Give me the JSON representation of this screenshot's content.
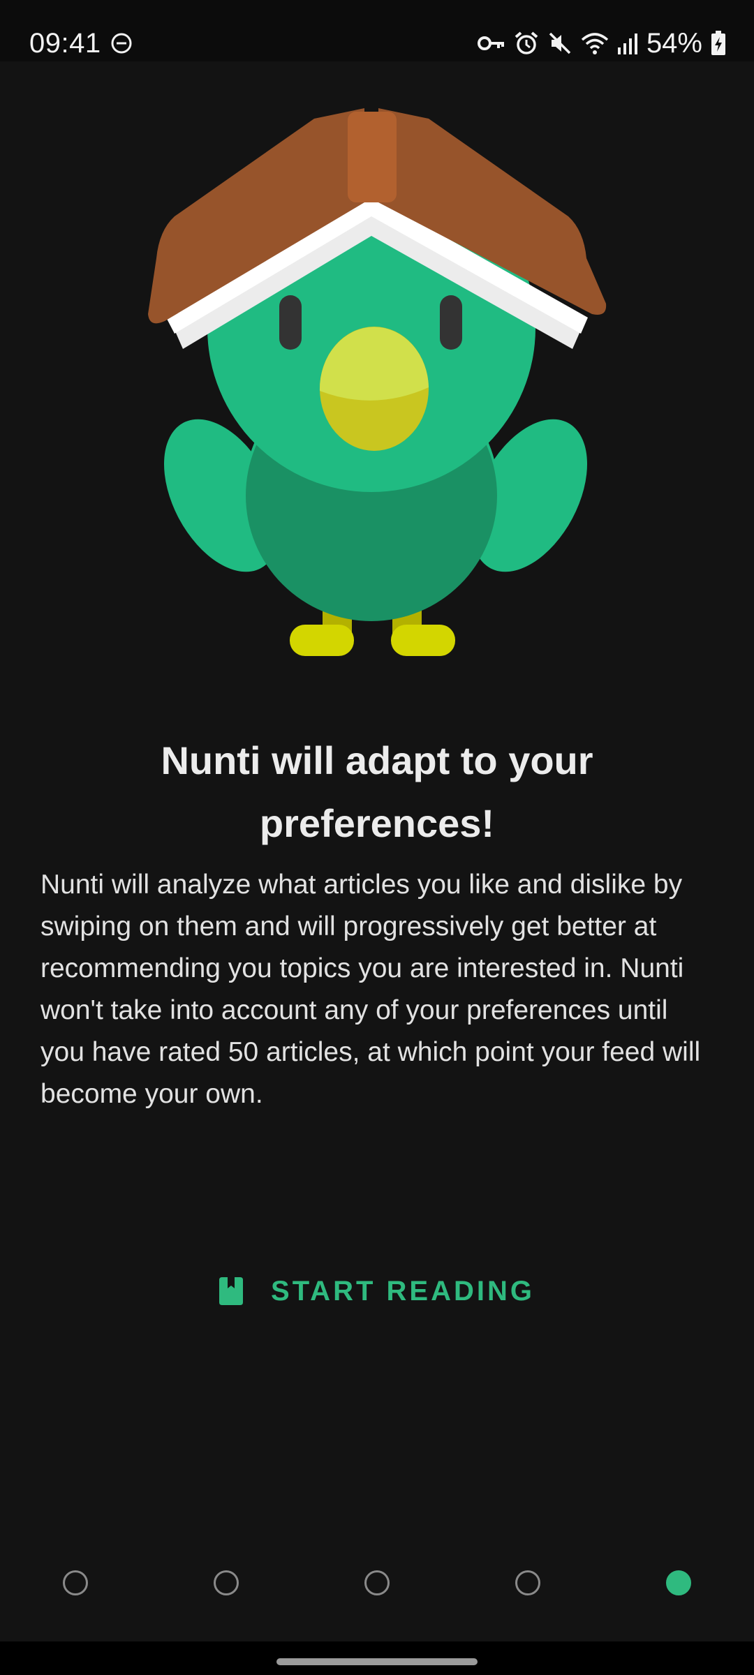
{
  "status_bar": {
    "time": "09:41",
    "battery": "54%",
    "icons": [
      "dnd-icon",
      "vpn-key-icon",
      "alarm-icon",
      "mute-icon",
      "wifi-icon",
      "signal-icon",
      "battery-charging-icon"
    ]
  },
  "illustration": {
    "name": "bird-reading-book-mascot",
    "colors": {
      "book": "#97542b",
      "book_spine": "#b2612f",
      "body": "#20bb82",
      "belly": "#1a9164",
      "beak": "#d1e04b",
      "feet": "#d3d600"
    }
  },
  "onboarding": {
    "title": "Nunti will adapt to your preferences!",
    "description": "Nunti will analyze what articles you like and dislike by swiping on them and will progressively get better at recommending you topics you are interested in. Nunti won't take into account any of your preferences until you have rated 50 articles, at which point your feed will become your own.",
    "start_button": {
      "label": "START READING",
      "icon": "book-icon"
    }
  },
  "pagination": {
    "total": 5,
    "current": 5
  },
  "theme": {
    "accent": "#2fba7f",
    "background": "#131313"
  }
}
